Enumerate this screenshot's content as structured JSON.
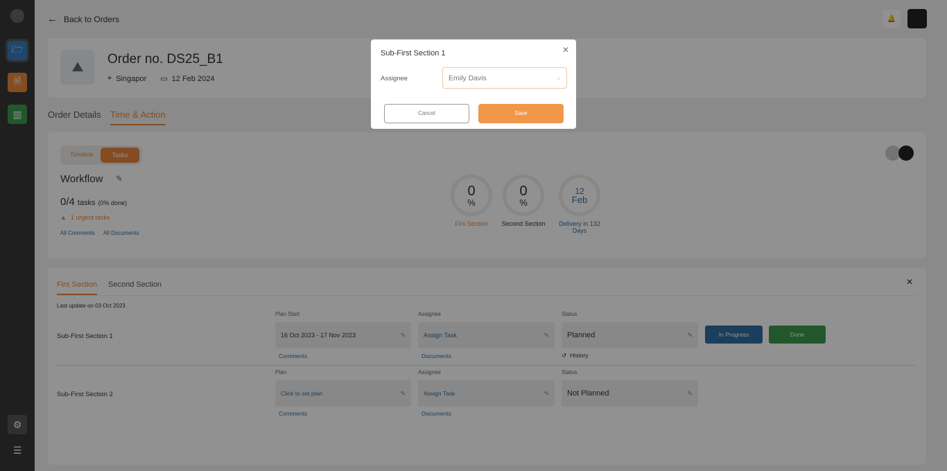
{
  "header": {
    "back_label": "Back to Orders"
  },
  "order": {
    "title": "Order no. DS25_B1",
    "location": "Singapor",
    "date": "12 Feb 2024"
  },
  "tabs": [
    "Order Details",
    "Time & Action"
  ],
  "toggle": [
    "Timeline",
    "Tasks"
  ],
  "workflow": {
    "title": "Workflow",
    "count": "0/4",
    "tasks_word": "tasks",
    "done": "(0% done)",
    "urgent": "1 urgent tasks",
    "all_comments": "All Comments",
    "all_documents": "All Documents"
  },
  "stats": [
    {
      "big": "0",
      "small": "%",
      "label": "Firs Section"
    },
    {
      "big": "0",
      "small": "%",
      "label": "Second Section"
    },
    {
      "big": "12",
      "small": "Feb",
      "label": "Delivery in 132 Days"
    }
  ],
  "sections": {
    "tabs": [
      "Firs Section",
      "Second Section"
    ],
    "last_update": "Last update on 03 Oct 2023",
    "rows": [
      {
        "name": "Sub-First Section 1",
        "plan_label": "Plan Start",
        "plan": "16 Oct 2023 - 17 Nov 2023",
        "assignee_label": "Assignee",
        "assignee": "Assign Task",
        "status_label": "Status",
        "status": "Planned",
        "comments": "Comments",
        "documents": "Documents",
        "history": "History",
        "in_progress": "In Progress",
        "done": "Done"
      },
      {
        "name": "Sub-First Section 2",
        "plan_label": "Plan",
        "plan": "Click to set plan",
        "assignee_label": "Assignee",
        "assignee": "Assign Task",
        "status_label": "Status",
        "status": "Not Planned",
        "comments": "Comments",
        "documents": "Documents"
      }
    ]
  },
  "modal": {
    "title": "Sub-First Section 1",
    "assignee_label": "Assignee",
    "assignee_value": "Emily Davis",
    "cancel": "Cancel",
    "save": "Save"
  },
  "colors": {
    "accent": "#e8873a",
    "blue": "#2f6da3",
    "green": "#3c9a4e"
  }
}
